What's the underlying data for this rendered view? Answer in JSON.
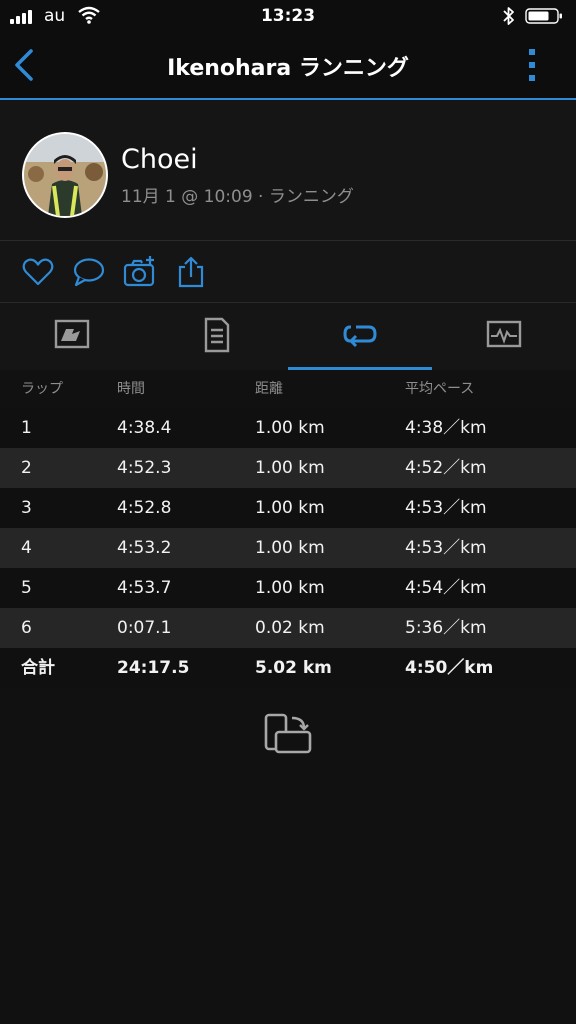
{
  "status_bar": {
    "carrier": "au",
    "time": "13:23"
  },
  "nav": {
    "title": "Ikenohara ランニング"
  },
  "profile": {
    "name": "Choei",
    "meta": "11月 1 @ 10:09 · ランニング"
  },
  "colors": {
    "accent": "#2f8bd6",
    "background": "#111111",
    "row_alt": "#262626",
    "muted_text": "#8e8e8e"
  },
  "actions": [
    "heart-icon",
    "comment-icon",
    "camera-add-icon",
    "share-icon"
  ],
  "tabs": [
    "overview-tab",
    "details-tab",
    "laps-tab",
    "charts-tab"
  ],
  "active_tab": 2,
  "laps": {
    "headers": [
      "ラップ",
      "時間",
      "距離",
      "平均ペース"
    ],
    "rows": [
      [
        "1",
        "4:38.4",
        "1.00 km",
        "4:38／km"
      ],
      [
        "2",
        "4:52.3",
        "1.00 km",
        "4:52／km"
      ],
      [
        "3",
        "4:52.8",
        "1.00 km",
        "4:53／km"
      ],
      [
        "4",
        "4:53.2",
        "1.00 km",
        "4:53／km"
      ],
      [
        "5",
        "4:53.7",
        "1.00 km",
        "4:54／km"
      ],
      [
        "6",
        "0:07.1",
        "0.02 km",
        "5:36／km"
      ]
    ],
    "total": [
      "合計",
      "24:17.5",
      "5.02 km",
      "4:50／km"
    ]
  }
}
